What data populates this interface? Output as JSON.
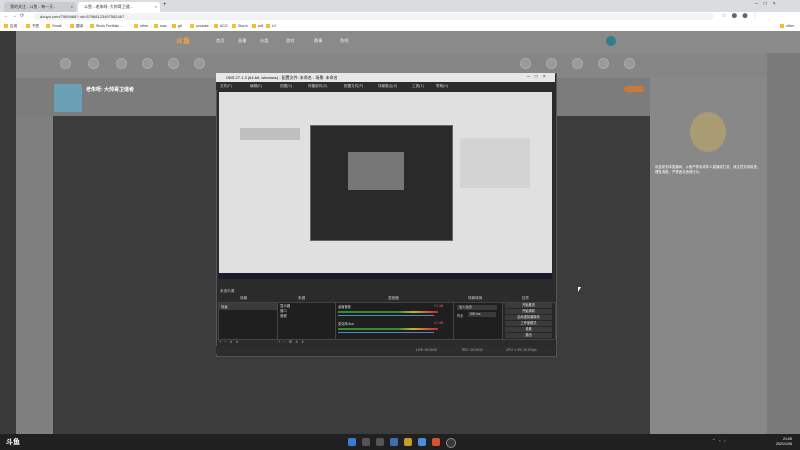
{
  "browser": {
    "tabs": [
      {
        "label": "我的关注 - 斗鱼 - 每一天..."
      },
      {
        "label": "斗鱼 - 老朱呀: 大帅哥卫道...",
        "active": true
      }
    ],
    "url": "douyu.com/7969468?  rid=57968123497582467",
    "bookmarks": [
      "应用",
      "书签",
      "Gmail",
      "翻译",
      "Stock Portfolio ...",
      "other",
      "mac",
      "git",
      "youtube",
      "ACG",
      "Storm",
      "pdf",
      "UI",
      "other"
    ]
  },
  "site": {
    "logo": "斗鱼",
    "nav": [
      "首页",
      "直播",
      "分类",
      "游戏",
      "赛事",
      "鱼吧"
    ],
    "streamer": "老朱呀: 大帅哥卫道者",
    "chat_text": "欢迎来到本直播间，斗鱼严禁未成年人直播或打赏，请注意文明用语，理性消费，严禁违法违规行为。"
  },
  "obs": {
    "title": "OBS 27.1.3 (64-bit, windows) - 配置文件: 未命名 - 场景: 未命名",
    "menu": [
      "文件(F)",
      "编辑(E)",
      "视图(V)",
      "停靠部件(D)",
      "配置文件(P)",
      "场景集合(S)",
      "工具(T)",
      "帮助(H)"
    ],
    "docks": [
      "场景",
      "来源",
      "混音器",
      "场景转换",
      "控件"
    ],
    "scene_item": "场景",
    "sources": [
      "显示器",
      "窗口",
      "音频"
    ],
    "mixer": [
      {
        "name": "桌面音频",
        "level": "0.0 dB"
      },
      {
        "name": "麦克风/Aux",
        "level": "0.0 dB"
      }
    ],
    "transition": {
      "type": "淡入淡出",
      "duration_label": "时长",
      "duration": "300 ms"
    },
    "controls": [
      "开始推流",
      "开始录制",
      "启动虚拟摄像机",
      "工作室模式",
      "设置",
      "退出"
    ],
    "status": [
      "LIVE: 00:00:00",
      "REC: 00:00:00",
      "CPU: 1.4%, 30.00 fps"
    ],
    "preview_hint": "未选中源"
  },
  "taskbar": {
    "logo": "斗鱼",
    "time": "21:05",
    "date": "2021/12/6"
  }
}
